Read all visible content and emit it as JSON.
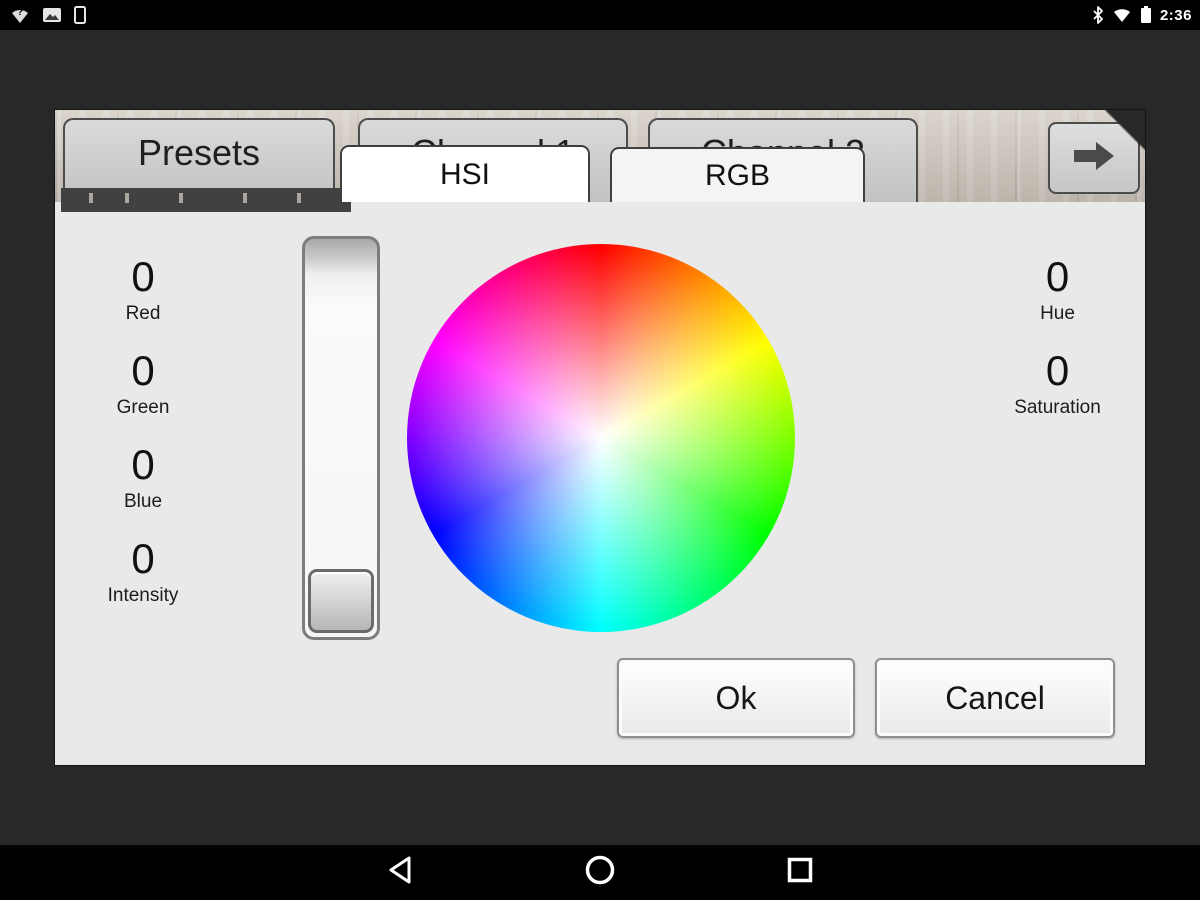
{
  "status_bar": {
    "time": "2:36",
    "left_icons": [
      {
        "name": "network-question-icon"
      },
      {
        "name": "image-icon"
      },
      {
        "name": "device-icon"
      }
    ],
    "right_icons": [
      {
        "name": "bluetooth-icon"
      },
      {
        "name": "wifi-icon"
      },
      {
        "name": "battery-icon"
      }
    ]
  },
  "tab_bar": {
    "tabs": [
      {
        "label": "Presets"
      },
      {
        "label": "Channel 1"
      },
      {
        "label": "Channel 2"
      }
    ],
    "arrow_icon": "arrow-right-icon"
  },
  "dialog": {
    "tabs": [
      {
        "label": "HSI",
        "selected": true
      },
      {
        "label": "RGB",
        "selected": false
      }
    ],
    "left_values": [
      {
        "value": "0",
        "label": "Red"
      },
      {
        "value": "0",
        "label": "Green"
      },
      {
        "value": "0",
        "label": "Blue"
      },
      {
        "value": "0",
        "label": "Intensity"
      }
    ],
    "right_values": [
      {
        "value": "0",
        "label": "Hue"
      },
      {
        "value": "0",
        "label": "Saturation"
      }
    ],
    "slider": {
      "value": "0",
      "position": "bottom"
    },
    "color_wheel": {
      "hues": [
        "#ff0000",
        "#ffff00",
        "#00ff00",
        "#00ffff",
        "#0000ff",
        "#ff00ff"
      ],
      "center": "#ffffff"
    },
    "buttons": [
      {
        "label": "Ok"
      },
      {
        "label": "Cancel"
      }
    ]
  },
  "nav_bar": {
    "icons": [
      {
        "name": "back-icon"
      },
      {
        "name": "home-icon"
      },
      {
        "name": "recents-icon"
      }
    ]
  },
  "colors": {
    "background": "#282828",
    "dialog_bg": "#e9e9e9",
    "tab_bg": "#c9c9c9",
    "selected_tab_bg": "#ffffff",
    "status_bar_bg": "#000000"
  }
}
